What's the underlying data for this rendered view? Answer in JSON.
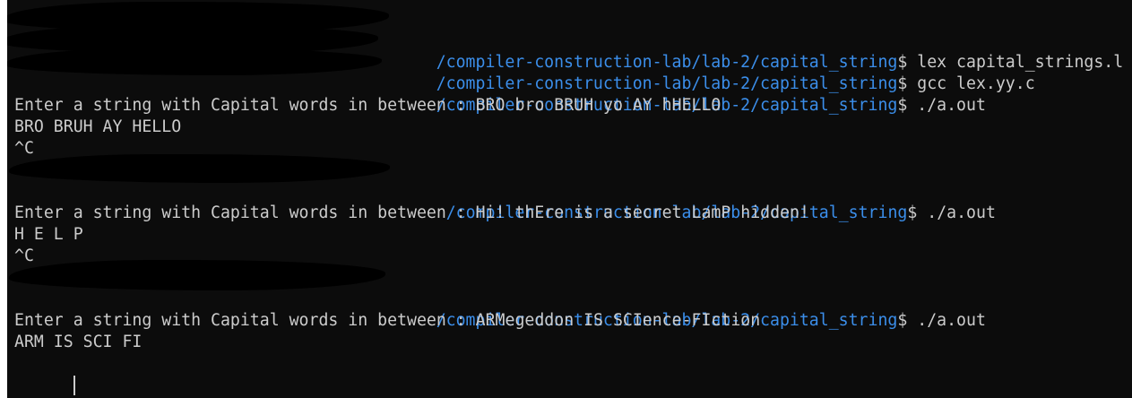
{
  "terminal": {
    "lines": [
      {
        "kind": "prompt",
        "path": "/compiler-construction-lab/lab-2/capital_string",
        "symbol": "$ ",
        "command": "lex capital_strings.l"
      },
      {
        "kind": "prompt",
        "path": "/compiler-construction-lab/lab-2/capital_string",
        "symbol": "$ ",
        "command": "gcc lex.yy.c"
      },
      {
        "kind": "prompt",
        "path": "/compiler-construction-lab/lab-2/capital_string",
        "symbol": "$ ",
        "command": "./a.out"
      },
      {
        "kind": "blank"
      },
      {
        "kind": "output",
        "text": "Enter a string with Capital words in between : BRO bro BRUH yo AY hHELLO"
      },
      {
        "kind": "output",
        "text": "BRO BRUH AY HELLO"
      },
      {
        "kind": "output",
        "text": "^C"
      },
      {
        "kind": "prompt",
        "path": "/compiler-construction-lab/lab-2/capital_string",
        "symbol": "$ ",
        "command": "./a.out"
      },
      {
        "kind": "blank"
      },
      {
        "kind": "output",
        "text": "Enter a string with Capital words in between : Hi! thEre is a secret LamP hidden!"
      },
      {
        "kind": "output",
        "text": "H E L P"
      },
      {
        "kind": "output",
        "text": "^C"
      },
      {
        "kind": "prompt",
        "path": "/compiler-construction-lab/lab-2/capital_string",
        "symbol": "$ ",
        "command": "./a.out"
      },
      {
        "kind": "blank"
      },
      {
        "kind": "output",
        "text": "Enter a string with Capital words in between : ARMegeddon IS SCIence-FIction"
      },
      {
        "kind": "output",
        "text": "ARM IS SCI FI"
      },
      {
        "kind": "cursor"
      }
    ]
  },
  "colors": {
    "background": "#0c0c0c",
    "path": "#3b8eea",
    "text": "#cccccc",
    "redaction": "#000000"
  }
}
